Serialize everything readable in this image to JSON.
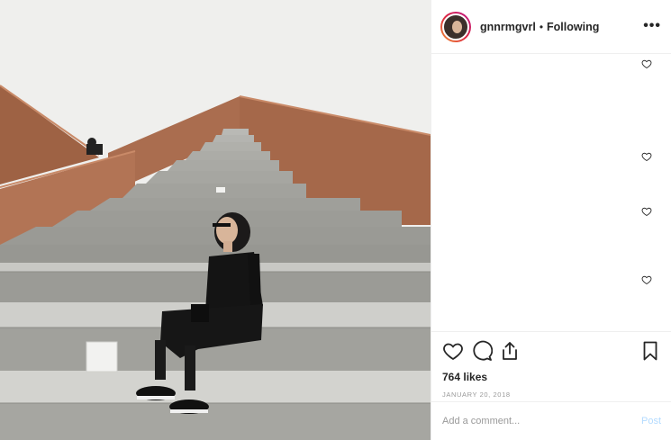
{
  "post": {
    "username": "gnnrmgvrl",
    "separator": "•",
    "follow_status": "Following",
    "more_label": "•••",
    "likes": "764 likes",
    "date": "JANUARY 20, 2018"
  },
  "comment_box": {
    "placeholder": "Add a comment...",
    "post_label": "Post"
  },
  "comment_like_icons": [
    "heart-icon",
    "heart-icon",
    "heart-icon",
    "heart-icon"
  ],
  "action_icons": [
    "heart-icon",
    "comment-icon",
    "share-icon",
    "bookmark-icon"
  ],
  "colors": {
    "post_button_disabled": "#b3dbff",
    "date_text": "#999999",
    "divider": "#efefef"
  }
}
